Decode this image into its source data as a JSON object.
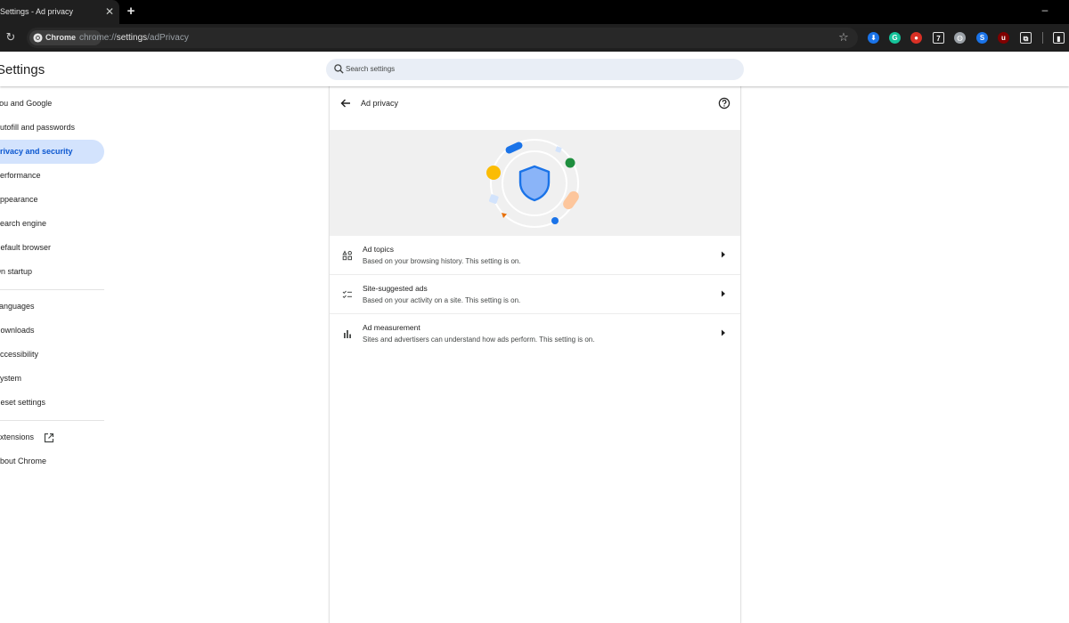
{
  "browser": {
    "tab_title": "Settings - Ad privacy",
    "tab_close": "✕",
    "new_tab": "+",
    "minimize": "–",
    "reload": "↻",
    "chip_label": "Chrome",
    "url_prefix": "chrome://",
    "url_host": "settings",
    "url_path": "/adPrivacy",
    "bookmark_star": "☆",
    "extensions": [
      {
        "name": "download-extension-icon",
        "color": "#1a73e8",
        "glyph": "⬇"
      },
      {
        "name": "grammarly-extension-icon",
        "color": "#15c39a",
        "glyph": "G"
      },
      {
        "name": "red-extension-icon",
        "color": "#d93025",
        "glyph": "●"
      },
      {
        "name": "translate-extension-icon",
        "color": "#1f1f1f",
        "glyph": "7"
      },
      {
        "name": "globe-extension-icon",
        "color": "#9aa0a6",
        "glyph": "◍"
      },
      {
        "name": "blue-extension-icon",
        "color": "#1a73e8",
        "glyph": "S"
      },
      {
        "name": "ublock-extension-icon",
        "color": "#800000",
        "glyph": "u"
      },
      {
        "name": "puzzle-extensions-icon",
        "color": "#1f1f1f",
        "glyph": "⧉"
      },
      {
        "name": "side-panel-icon",
        "color": "#1f1f1f",
        "glyph": "▮"
      }
    ]
  },
  "header": {
    "title": "Settings",
    "search_placeholder": "Search settings"
  },
  "sidebar": {
    "items": [
      {
        "label": "You and Google"
      },
      {
        "label": "Autofill and passwords"
      },
      {
        "label": "Privacy and security",
        "active": true
      },
      {
        "label": "Performance"
      },
      {
        "label": "Appearance"
      },
      {
        "label": "Search engine"
      },
      {
        "label": "Default browser"
      },
      {
        "label": "On startup"
      },
      {
        "label": "Languages"
      },
      {
        "label": "Downloads"
      },
      {
        "label": "Accessibility"
      },
      {
        "label": "System"
      },
      {
        "label": "Reset settings"
      },
      {
        "label": "Extensions"
      },
      {
        "label": "About Chrome"
      }
    ]
  },
  "main": {
    "title": "Ad privacy",
    "rows": [
      {
        "title": "Ad topics",
        "subtitle": "Based on your browsing history. This setting is on.",
        "icon": "ad-topics-icon"
      },
      {
        "title": "Site-suggested ads",
        "subtitle": "Based on your activity on a site. This setting is on.",
        "icon": "checklist-icon"
      },
      {
        "title": "Ad measurement",
        "subtitle": "Sites and advertisers can understand how ads perform. This setting is on.",
        "icon": "bar-chart-icon"
      }
    ]
  },
  "colors": {
    "accent": "#0b57d0",
    "active_nav_bg": "#d3e3fd",
    "shield_fill": "#8ab4f8",
    "shield_stroke": "#1a73e8"
  }
}
